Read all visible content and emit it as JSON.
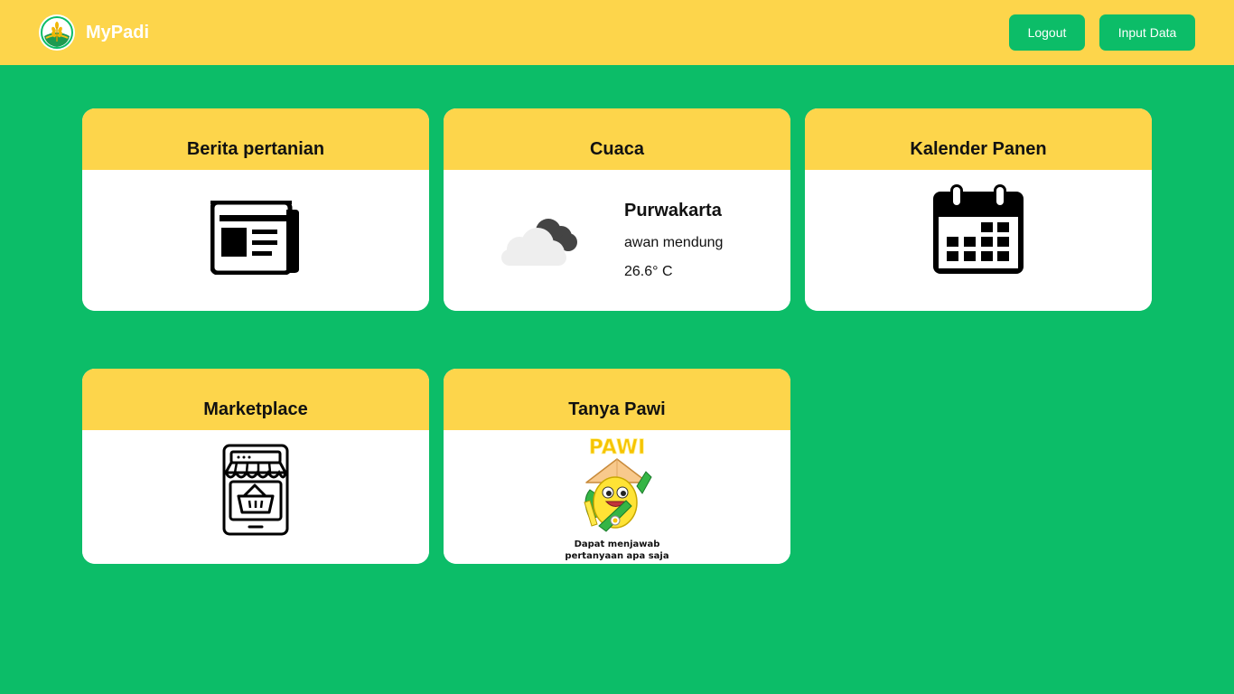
{
  "header": {
    "brand": "MyPadi",
    "logout_label": "Logout",
    "input_data_label": "Input Data"
  },
  "cards": {
    "berita": {
      "title": "Berita pertanian",
      "icon": "newspaper-icon"
    },
    "cuaca": {
      "title": "Cuaca",
      "icon": "cloudy-weather-icon",
      "city": "Purwakarta",
      "description": "awan mendung",
      "temperature": "26.6° C"
    },
    "kalender": {
      "title": "Kalender Panen",
      "icon": "calendar-icon"
    },
    "marketplace": {
      "title": "Marketplace",
      "icon": "shop-basket-icon"
    },
    "pawi": {
      "title": "Tanya Pawi",
      "icon": "pawi-mascot-icon",
      "mascot_name": "PAWI",
      "caption_line1": "Dapat menjawab",
      "caption_line2": "pertanyaan apa saja"
    }
  },
  "colors": {
    "background": "#0cbd68",
    "header": "#fdd54b",
    "button": "#0cbd68",
    "card_body": "#ffffff"
  }
}
